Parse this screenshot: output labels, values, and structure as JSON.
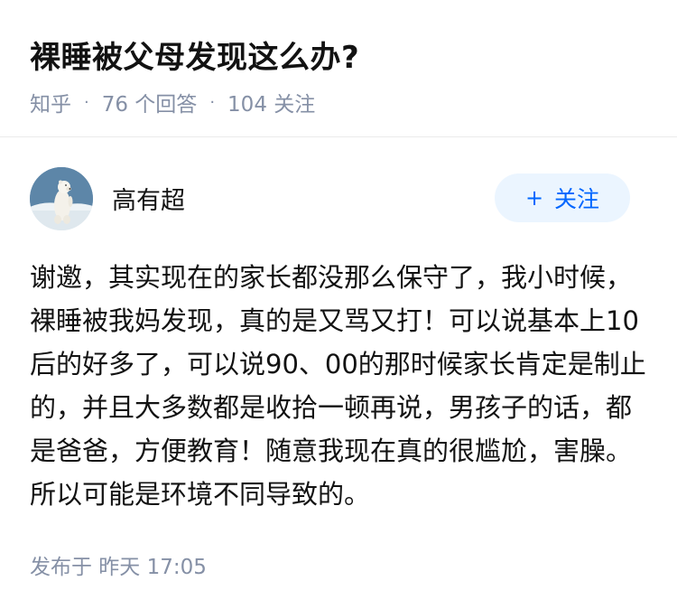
{
  "question": {
    "title": "裸睡被父母发现这么办?",
    "source": "知乎",
    "separator": "·",
    "answer_count": "76 个回答",
    "follower_count": "104 关注"
  },
  "author": {
    "name": "高有超",
    "avatar_icon": "polar-bear-avatar"
  },
  "follow_button": {
    "icon": "plus-icon",
    "icon_glyph": "+",
    "label": "关注"
  },
  "answer": {
    "text": "谢邀，其实现在的家长都没那么保守了，我小时候，裸睡被我妈发现，真的是又骂又打！可以说基本上10后的好多了，可以说90、00的那时候家长肯定是制止的，并且大多数都是收拾一顿再说，男孩子的话，都是爸爸，方便教育！随意我现在真的很尴尬，害臊。所以可能是环境不同导致的。"
  },
  "publish": {
    "time": "发布于 昨天 17:05"
  },
  "colors": {
    "title": "#121212",
    "meta": "#8590a6",
    "accent": "#0066ff",
    "follow_bg": "#ebf5ff",
    "divider": "#ebebeb"
  }
}
